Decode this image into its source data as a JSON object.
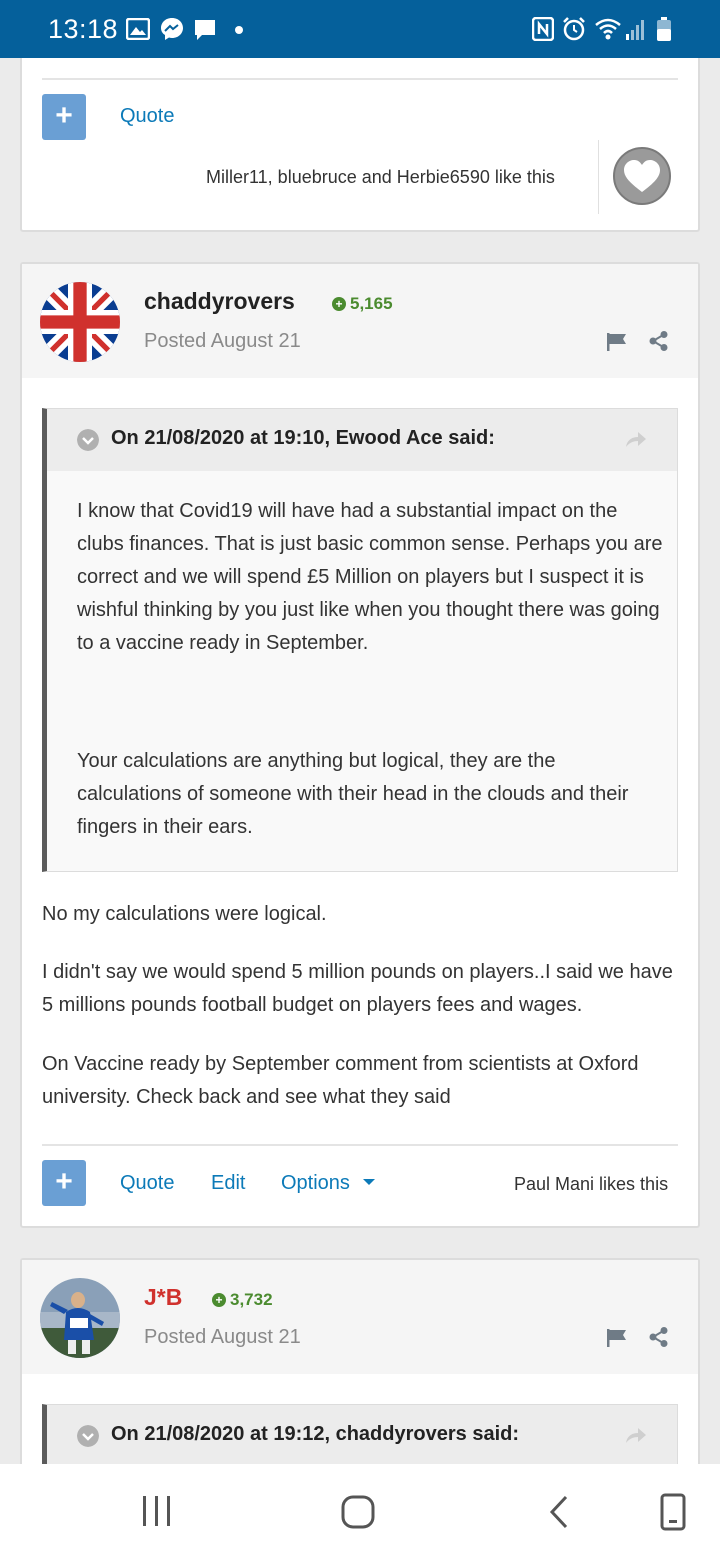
{
  "status_bar": {
    "time": "13:18",
    "left_icons": [
      "image-icon",
      "messenger-icon",
      "chat-icon",
      "dot-icon"
    ],
    "right_icons": [
      "nfc-icon",
      "alarm-icon",
      "wifi-icon",
      "signal-icon",
      "battery-icon"
    ]
  },
  "prev_post": {
    "quote_label": "Quote",
    "likes_text": "Miller11, bluebruce and Herbie6590 like this"
  },
  "post1": {
    "username": "chaddyrovers",
    "reputation": "5,165",
    "posted": "Posted August 21",
    "quote": {
      "citation": "On 21/08/2020 at 19:10, Ewood Ace said:",
      "paragraphs": [
        "I know that Covid19 will have had a substantial impact on the clubs finances. That is just basic common sense. Perhaps you are correct and we will spend £5 Million on players but I suspect it is wishful thinking by you just like when you thought there was going to a vaccine ready in September.",
        "Your calculations are anything but logical, they are the calculations of someone with their head in the clouds and their fingers in their ears."
      ]
    },
    "paragraphs": [
      "No my calculations were logical.",
      "I didn't say we would spend 5 million pounds on players..I said we have 5 millions pounds football budget on players fees and wages.",
      "On Vaccine ready by September comment from scientists at Oxford university. Check back and see what they said"
    ],
    "actions": {
      "quote": "Quote",
      "edit": "Edit",
      "options": "Options"
    },
    "likes_text": "Paul Mani likes this"
  },
  "post2": {
    "username": "J*B",
    "username_color": "#d0312d",
    "reputation": "3,732",
    "posted": "Posted August 21",
    "quote": {
      "citation": "On 21/08/2020 at 19:12, chaddyrovers said:"
    }
  },
  "nav_bar": {
    "icons": [
      "recent-apps-icon",
      "home-icon",
      "back-icon",
      "screenshot-icon"
    ]
  },
  "colors": {
    "status_bar": "#05609b",
    "link": "#0c7ab8",
    "plus_button": "#6a9fd4",
    "reputation": "#4b8b2f"
  }
}
